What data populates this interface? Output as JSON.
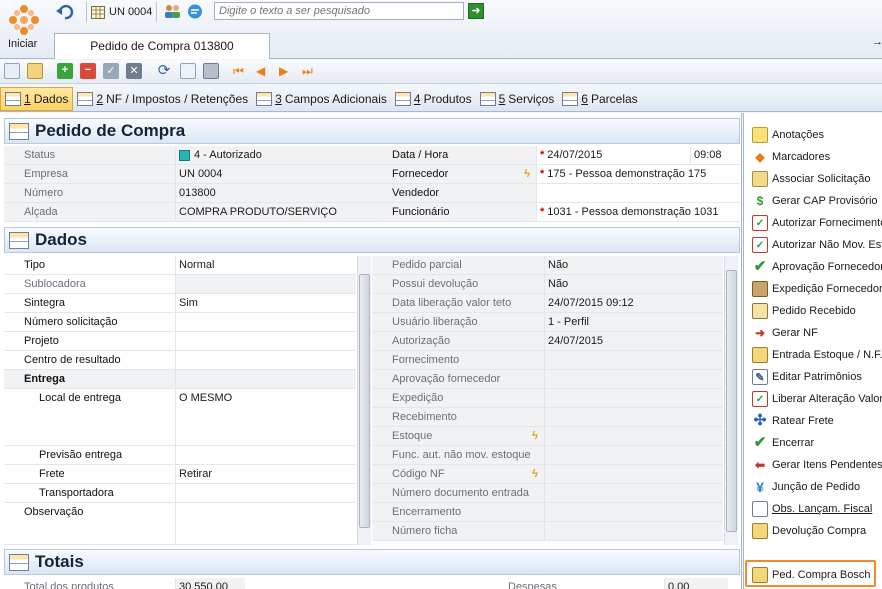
{
  "toolbar": {
    "home_label": "Iniciar",
    "unit": "UN 0004",
    "search_placeholder": "Digite o texto a ser pesquisado"
  },
  "document_tab": "Pedido de Compra 013800",
  "subtabs": [
    {
      "num": "1",
      "label": " Dados"
    },
    {
      "num": "2",
      "label": " NF / Impostos / Retenções"
    },
    {
      "num": "3",
      "label": " Campos Adicionais"
    },
    {
      "num": "4",
      "label": " Produtos"
    },
    {
      "num": "5",
      "label": " Serviços"
    },
    {
      "num": "6",
      "label": " Parcelas"
    }
  ],
  "header_section": {
    "title": "Pedido de Compra",
    "left": [
      {
        "label": "Status",
        "value": "4 - Autorizado"
      },
      {
        "label": "Empresa",
        "value": "UN 0004"
      },
      {
        "label": "Número",
        "value": "013800"
      },
      {
        "label": "Alçada",
        "value": "COMPRA PRODUTO/SERVIÇO"
      }
    ],
    "right": [
      {
        "label": "Data / Hora",
        "value": "24/07/2015",
        "time": "09:08"
      },
      {
        "label": "Fornecedor",
        "value": "175 - Pessoa demonstração 175"
      },
      {
        "label": "Vendedor",
        "value": ""
      },
      {
        "label": "Funcionário",
        "value": "1031 - Pessoa demonstração 1031"
      }
    ]
  },
  "dados_section": {
    "title": "Dados",
    "left": [
      {
        "label": "Tipo",
        "value": "Normal"
      },
      {
        "label": "Sublocadora",
        "value": ""
      },
      {
        "label": "Sintegra",
        "value": "Sim"
      },
      {
        "label": "Número solicitação",
        "value": ""
      },
      {
        "label": "Projeto",
        "value": ""
      },
      {
        "label": "Centro de resultado",
        "value": ""
      },
      {
        "label": "Entrega",
        "value": ""
      },
      {
        "label": "Local de entrega",
        "value": "O MESMO"
      },
      {
        "label": "Previsão entrega",
        "value": ""
      },
      {
        "label": "Frete",
        "value": "Retirar"
      },
      {
        "label": "Transportadora",
        "value": ""
      },
      {
        "label": "Observação",
        "value": ""
      }
    ],
    "right": [
      {
        "label": "Pedido parcial",
        "value": "Não"
      },
      {
        "label": "Possui devolução",
        "value": "Não"
      },
      {
        "label": "Data liberação valor teto",
        "value": "24/07/2015 09:12"
      },
      {
        "label": "Usuário liberação",
        "value": "1 - Perfil"
      },
      {
        "label": "Autorização",
        "value": "24/07/2015"
      },
      {
        "label": "Fornecimento",
        "value": ""
      },
      {
        "label": "Aprovação fornecedor",
        "value": ""
      },
      {
        "label": "Expedição",
        "value": ""
      },
      {
        "label": "Recebimento",
        "value": ""
      },
      {
        "label": "Estoque",
        "value": ""
      },
      {
        "label": "Func. aut. não mov. estoque",
        "value": ""
      },
      {
        "label": "Código NF",
        "value": ""
      },
      {
        "label": "Número documento entrada",
        "value": ""
      },
      {
        "label": "Encerramento",
        "value": ""
      },
      {
        "label": "Número ficha",
        "value": ""
      }
    ]
  },
  "totais_section": {
    "title": "Totais",
    "left_label": "Total dos produtos",
    "left_value": "30.550,00",
    "right_label": "Despesas",
    "right_value": "0,00"
  },
  "sidebar": [
    {
      "label": "Anotações",
      "icon": "notes-icon"
    },
    {
      "label": "Marcadores",
      "icon": "tag-icon"
    },
    {
      "label": "Associar Solicitação",
      "icon": "associate-icon"
    },
    {
      "label": "Gerar CAP Provisório",
      "icon": "dollar-icon"
    },
    {
      "label": "Autorizar Fornecimento",
      "icon": "calendar-check-icon"
    },
    {
      "label": "Autorizar Não Mov. Estoque",
      "icon": "calendar-check-icon"
    },
    {
      "label": "Aprovação Fornecedor",
      "icon": "checkmark-icon"
    },
    {
      "label": "Expedição Fornecedor",
      "icon": "package-icon"
    },
    {
      "label": "Pedido Recebido",
      "icon": "received-icon"
    },
    {
      "label": "Gerar NF",
      "icon": "arrow-right-icon"
    },
    {
      "label": "Entrada Estoque / N.F.",
      "icon": "stock-entry-icon"
    },
    {
      "label": "Editar Patrimônios",
      "icon": "edit-icon"
    },
    {
      "label": "Liberar Alteração Valores",
      "icon": "calendar-check-icon"
    },
    {
      "label": "Ratear Frete",
      "icon": "split-icon"
    },
    {
      "label": "Encerrar",
      "icon": "checkmark-icon"
    },
    {
      "label": "Gerar Itens Pendentes",
      "icon": "arrow-left-icon"
    },
    {
      "label": "Junção de Pedido",
      "icon": "merge-icon"
    },
    {
      "label": "Obs. Lançam. Fiscal",
      "icon": "document-icon"
    },
    {
      "label": "Devolução Compra",
      "icon": "return-icon"
    },
    {
      "label": "Ped. Compra Bosch",
      "icon": "order-icon"
    }
  ]
}
